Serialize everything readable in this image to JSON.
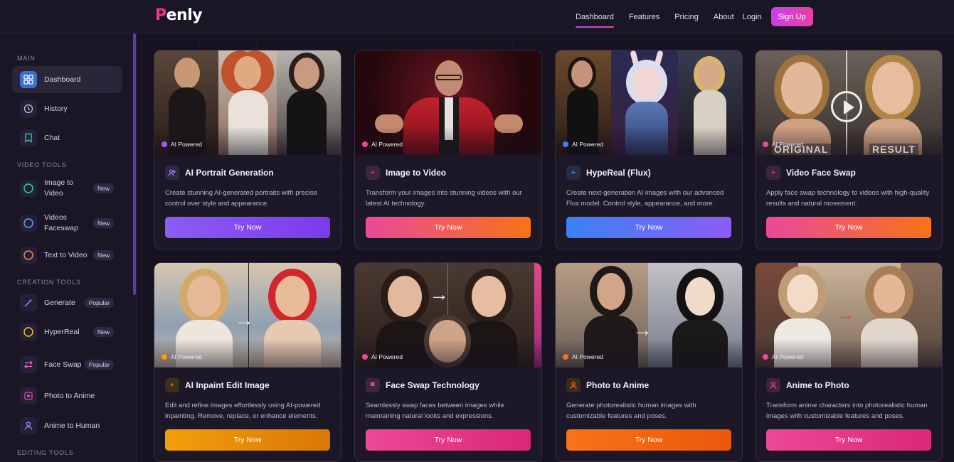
{
  "brand": {
    "name_first": "P",
    "name_rest": "enly"
  },
  "nav": {
    "links": [
      "Dashboard",
      "Features",
      "Pricing",
      "About"
    ],
    "login": "Login",
    "signup": "Sign Up"
  },
  "sidebar": {
    "sections": [
      {
        "title": "MAIN"
      },
      {
        "title": "VIDEO TOOLS"
      },
      {
        "title": "CREATION TOOLS"
      },
      {
        "title": "EDITING TOOLS"
      }
    ],
    "items": [
      {
        "label": "Dashboard",
        "badge": ""
      },
      {
        "label": "History",
        "badge": ""
      },
      {
        "label": "Chat",
        "badge": ""
      },
      {
        "label": "Image to Video",
        "badge": "New"
      },
      {
        "label": "Videos Faceswap",
        "badge": "New"
      },
      {
        "label": "Text to Video",
        "badge": "New"
      },
      {
        "label": "Generate",
        "badge": "Popular"
      },
      {
        "label": "HyperReal",
        "badge": "New"
      },
      {
        "label": "Face Swap",
        "badge": "Popular"
      },
      {
        "label": "Photo to Anime",
        "badge": ""
      },
      {
        "label": "Anime to Human",
        "badge": ""
      }
    ]
  },
  "cards": [
    {
      "badge": "AI Powered",
      "title": "AI Portrait Generation",
      "desc": "Create stunning AI-generated portraits with precise control over style and appearance.",
      "button": "Try Now"
    },
    {
      "badge": "AI Powered",
      "title": "Image to Video",
      "desc": "Transform your images into stunning videos with our latest AI technology.",
      "button": "Try Now"
    },
    {
      "badge": "AI Powered",
      "title": "HypeReal (Flux)",
      "desc": "Create next-generation AI images with our advanced Flux model. Control style, appearance, and more.",
      "button": "Try Now"
    },
    {
      "badge": "AI Powered",
      "title": "Video Face Swap",
      "desc": "Apply face swap technology to videos with high-quality results and natural movement.",
      "button": "Try Now",
      "overlay_left": "ORIGINAL",
      "overlay_right": "RESULT"
    },
    {
      "badge": "AI Powered",
      "title": "AI Inpaint Edit Image",
      "desc": "Edit and refine images effortlessly using AI-powered inpainting. Remove, replace, or enhance elements.",
      "button": "Try Now"
    },
    {
      "badge": "AI Powered",
      "title": "Face Swap Technology",
      "desc": "Seamlessly swap faces between images while maintaining natural looks and expressions.",
      "button": "Try Now"
    },
    {
      "badge": "AI Powered",
      "title": "Photo to Anime",
      "desc": "Generate photorealistic human images with customizable features and poses.",
      "button": "Try Now"
    },
    {
      "badge": "AI Powered",
      "title": "Anime to Photo",
      "desc": "Transform anime characters into photorealistic human images with customizable features and poses.",
      "button": "Try Now"
    }
  ],
  "colors": {
    "accent": "#a855f7",
    "pink": "#ec4899",
    "orange": "#f97316",
    "blue": "#3b82f6"
  }
}
